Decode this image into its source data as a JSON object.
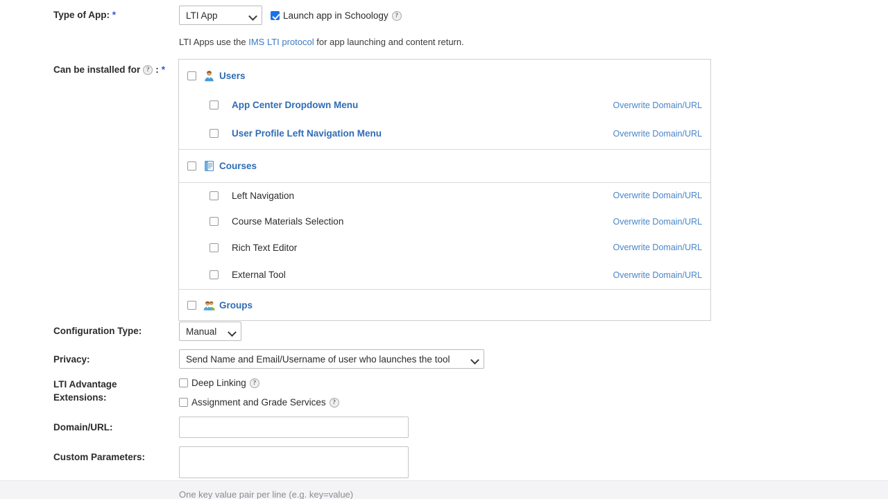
{
  "form": {
    "type_of_app": {
      "label": "Type of App:",
      "required_mark": "*",
      "select_value": "LTI App",
      "launch_checkbox_label": "Launch app in Schoology",
      "launch_checked": true,
      "help_glyph": "?",
      "note_prefix": "LTI Apps use the ",
      "note_link": "IMS LTI protocol",
      "note_suffix": " for app launching and content return."
    },
    "can_be_installed": {
      "label": "Can be installed for",
      "help_glyph": "?",
      "colon": ":",
      "required_mark": "*"
    },
    "configuration_type": {
      "label": "Configuration Type:",
      "select_value": "Manual"
    },
    "privacy": {
      "label": "Privacy:",
      "select_value": "Send Name and Email/Username of user who launches the tool"
    },
    "lti_advantage": {
      "label_line1": "LTI Advantage",
      "label_line2": "Extensions:",
      "deep_linking_label": "Deep Linking",
      "deep_linking_checked": false,
      "ags_label": "Assignment and Grade Services",
      "ags_checked": false,
      "help_glyph": "?"
    },
    "domain_url": {
      "label": "Domain/URL:",
      "value": "",
      "placeholder": ""
    },
    "custom_parameters": {
      "label": "Custom Parameters:",
      "value": "",
      "placeholder": "",
      "hint": "One key value pair per line (e.g. key=value)"
    }
  },
  "install_panel": {
    "overwrite_label": "Overwrite Domain/URL",
    "sections": [
      {
        "id": "users",
        "title": "Users",
        "icon": "user-icon",
        "checked": false,
        "title_is_link": true,
        "items": [
          {
            "label": "App Center Dropdown Menu",
            "checked": false,
            "is_link": true,
            "overwrite": true
          },
          {
            "label": "User Profile Left Navigation Menu",
            "checked": false,
            "is_link": true,
            "overwrite": true
          }
        ]
      },
      {
        "id": "courses",
        "title": "Courses",
        "icon": "course-book-icon",
        "checked": false,
        "title_is_link": true,
        "items": [
          {
            "label": "Left Navigation",
            "checked": false,
            "is_link": false,
            "overwrite": true
          },
          {
            "label": "Course Materials Selection",
            "checked": false,
            "is_link": false,
            "overwrite": true
          },
          {
            "label": "Rich Text Editor",
            "checked": false,
            "is_link": false,
            "overwrite": true
          },
          {
            "label": "External Tool",
            "checked": false,
            "is_link": false,
            "overwrite": true
          }
        ]
      },
      {
        "id": "groups",
        "title": "Groups",
        "icon": "groups-icon",
        "checked": false,
        "title_is_link": true,
        "items": []
      }
    ]
  },
  "colors": {
    "link": "#2f6cb5",
    "overwrite_link": "#4a86c8",
    "note_link": "#3a7bbf",
    "required": "#3b53d6",
    "checkbox_checked": "#1a73e8",
    "panel_border": "#cfcfcf",
    "divider": "#d9d9d9"
  }
}
